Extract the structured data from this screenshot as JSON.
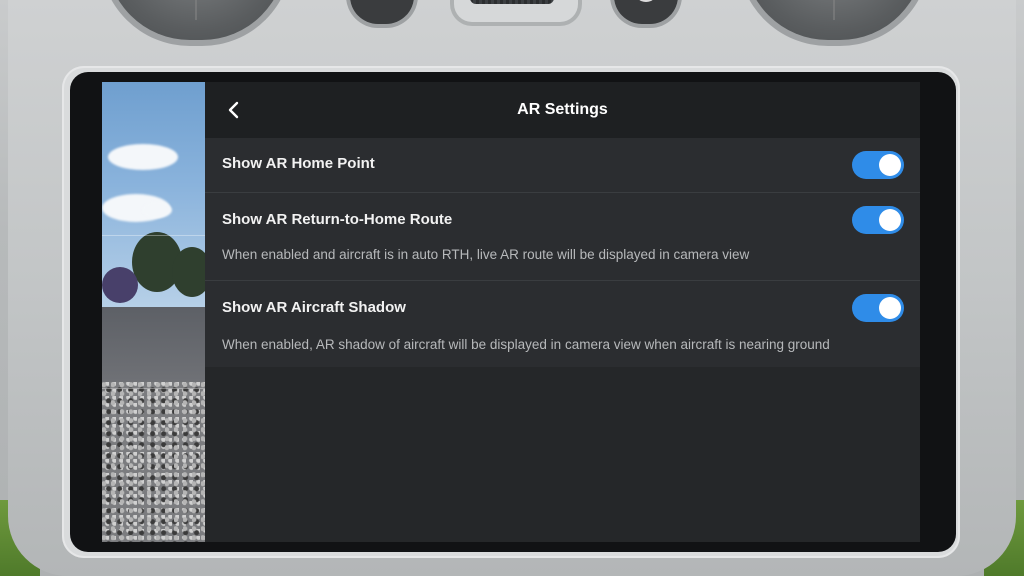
{
  "header": {
    "title": "AR Settings",
    "back_icon": "chevron-left-icon"
  },
  "settings": [
    {
      "title": "Show AR Home Point",
      "description": "",
      "enabled": true
    },
    {
      "title": "Show AR Return-to-Home Route",
      "description": "When enabled and aircraft is in auto RTH, live AR route will be displayed in camera view",
      "enabled": true
    },
    {
      "title": "Show AR Aircraft Shadow",
      "description": "When enabled, AR shadow of aircraft will be displayed in camera view when aircraft is nearing ground",
      "enabled": true
    }
  ],
  "colors": {
    "toggle_on": "#2f8ce8",
    "panel_bg": "#2b2d30",
    "header_bg": "#1e2022"
  }
}
